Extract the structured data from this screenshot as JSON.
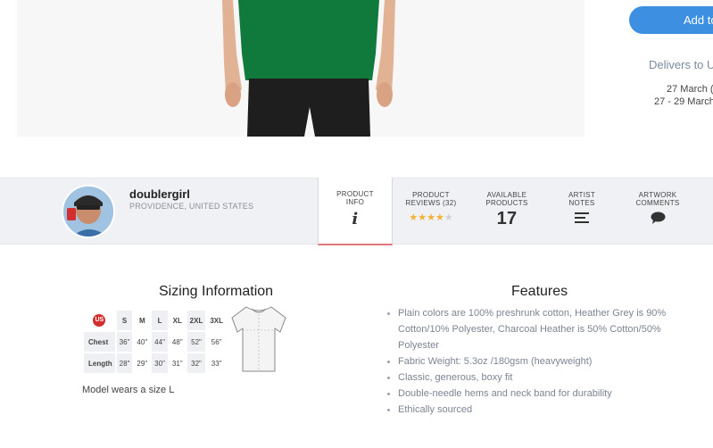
{
  "purchase": {
    "add_button_label": "Add to",
    "delivers_text": "Delivers to Ur",
    "date_standard": "27 March (",
    "date_express": "27 - 29 March"
  },
  "artist": {
    "name": "doublergirl",
    "location": "PROVIDENCE, UNITED STATES"
  },
  "tabs": [
    {
      "label_line1": "PRODUCT",
      "label_line2": "INFO",
      "icon": "info-icon",
      "active": true
    },
    {
      "label_line1": "PRODUCT",
      "label_line2": "REVIEWS (32)",
      "rating": 4,
      "max_rating": 5
    },
    {
      "label_line1": "AVAILABLE",
      "label_line2": "PRODUCTS",
      "count": "17"
    },
    {
      "label_line1": "ARTIST",
      "label_line2": "NOTES",
      "icon": "notes-icon"
    },
    {
      "label_line1": "ARTWORK",
      "label_line2": "COMMENTS",
      "icon": "comment-icon"
    }
  ],
  "sizing": {
    "title": "Sizing Information",
    "region_badge": "US",
    "sizes": [
      "S",
      "M",
      "L",
      "XL",
      "2XL",
      "3XL"
    ],
    "rows": [
      {
        "label": "Chest",
        "values": [
          "36\"",
          "40\"",
          "44\"",
          "48\"",
          "52\"",
          "56\""
        ]
      },
      {
        "label": "Length",
        "values": [
          "28\"",
          "29\"",
          "30\"",
          "31\"",
          "32\"",
          "33\""
        ]
      }
    ],
    "model_note": "Model wears a size L"
  },
  "features": {
    "title": "Features",
    "items": [
      "Plain colors are 100% preshrunk cotton, Heather Grey is 90% Cotton/10% Polyester, Charcoal Heather is 50% Cotton/50% Polyester",
      "Fabric Weight: 5.3oz /180gsm (heavyweight)",
      "Classic, generous, boxy fit",
      "Double-needle hems and neck band for durability",
      "Ethically sourced"
    ]
  },
  "colors": {
    "accent_blue": "#3d8fe2",
    "shirt_green": "#0f7a3c",
    "star_gold": "#f2b134",
    "active_tab_border": "#e07a7a"
  }
}
